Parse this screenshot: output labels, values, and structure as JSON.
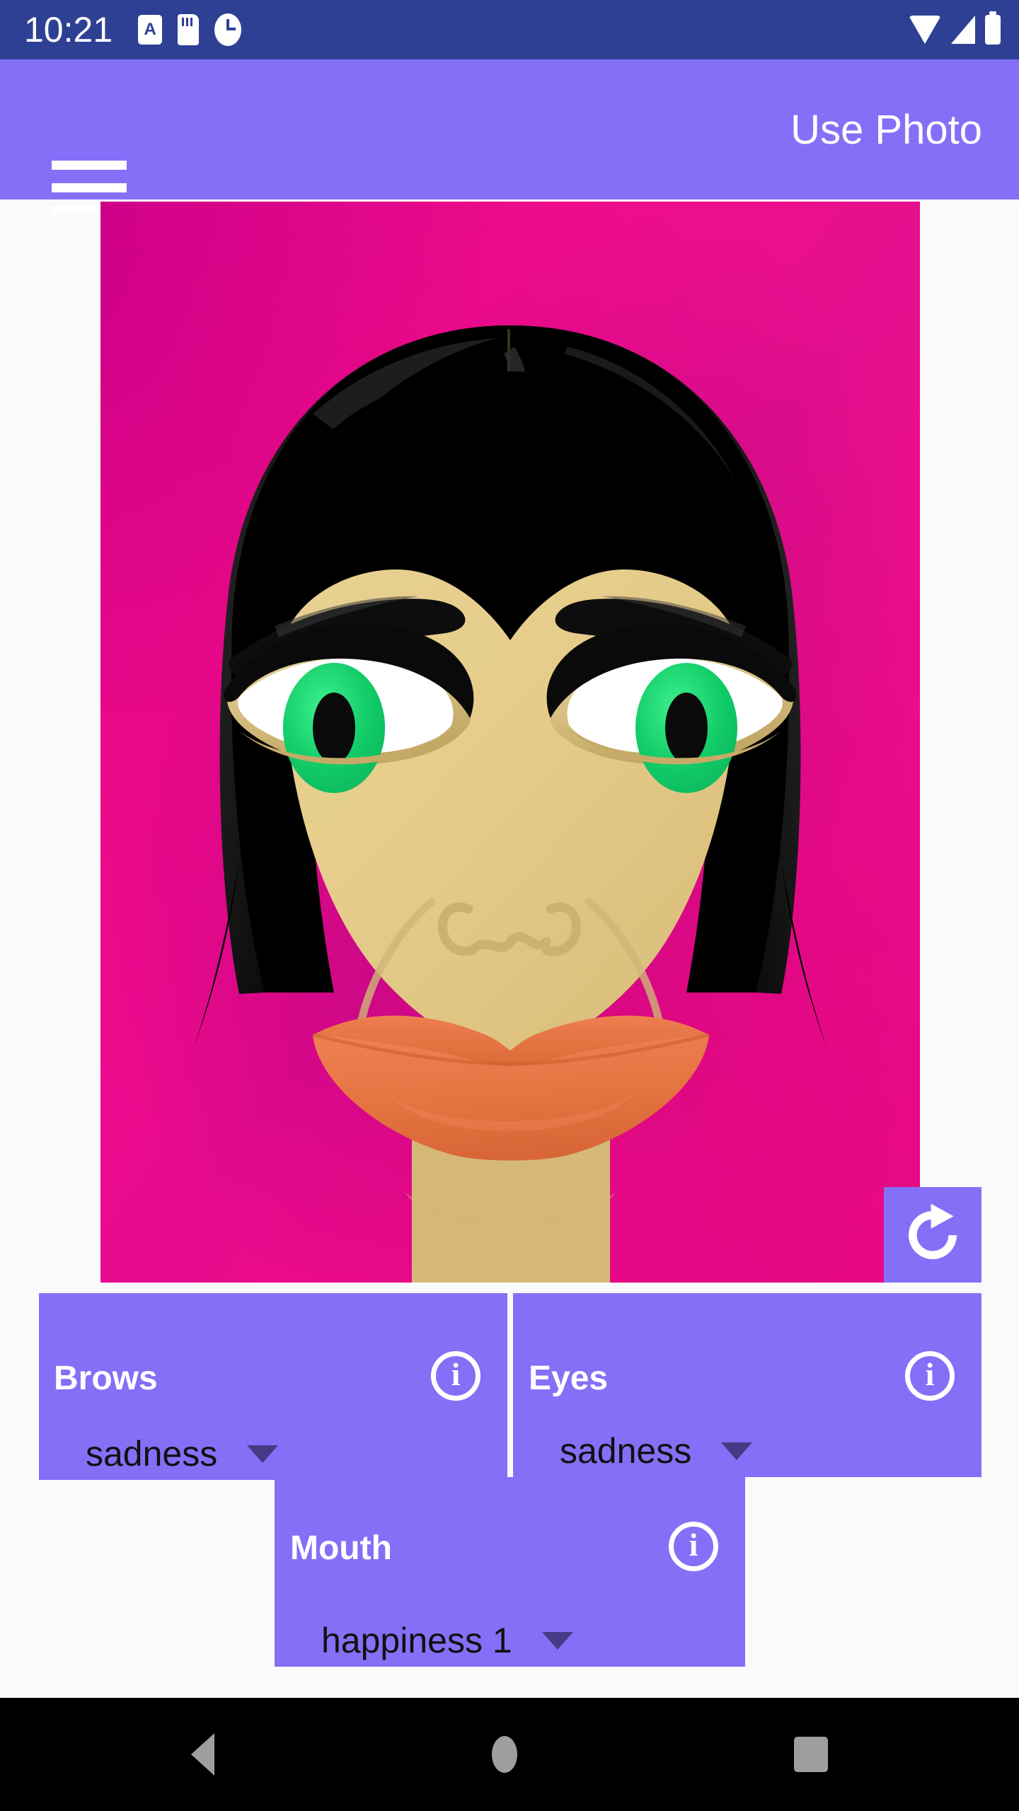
{
  "status_bar": {
    "time": "10:21",
    "left_icons": [
      "a-badge-icon",
      "sd-card-icon",
      "alarm-clock-icon"
    ],
    "right_icons": [
      "wifi-icon",
      "cellular-signal-icon",
      "battery-icon"
    ],
    "background_color": "#2e4094",
    "foreground_color": "#ffffff"
  },
  "app_bar": {
    "menu_icon": "hamburger-menu-icon",
    "action_label": "Use Photo",
    "background_color": "#8370f7",
    "text_color": "#ffffff"
  },
  "photo": {
    "description": "Cartoon avatar face with black center-parted hair, tan skin, green eyes, orange lips on a magenta background",
    "background_color": "#e5007e",
    "skin_color": "#e6ce8c",
    "hair_color": "#0a0a0a",
    "iris_color": "#14cf6e",
    "lip_color": "#e8794a",
    "refresh_icon": "refresh-icon"
  },
  "controls": {
    "cards": [
      {
        "id": "brows",
        "title": "Brows",
        "info_icon": "info-icon",
        "selected": "sadness",
        "caret_icon": "chevron-down-icon",
        "options": [
          "sadness"
        ]
      },
      {
        "id": "eyes",
        "title": "Eyes",
        "info_icon": "info-icon",
        "selected": "sadness",
        "caret_icon": "chevron-down-icon",
        "options": [
          "sadness"
        ]
      },
      {
        "id": "mouth",
        "title": "Mouth",
        "info_icon": "info-icon",
        "selected": "happiness 1",
        "caret_icon": "chevron-down-icon",
        "options": [
          "happiness 1"
        ]
      }
    ],
    "card_color": "#8370f7",
    "title_color": "#ffffff",
    "value_color": "#111111"
  },
  "nav_bar": {
    "back_icon": "triangle-back-icon",
    "home_icon": "circle-home-icon",
    "recents_icon": "square-recents-icon",
    "background_color": "#000000",
    "icon_color": "#9e9e9e"
  }
}
